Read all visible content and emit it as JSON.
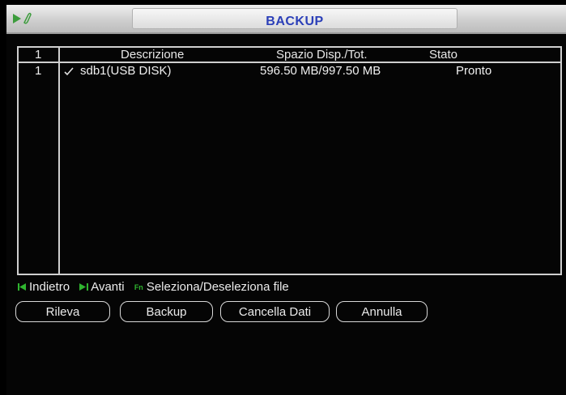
{
  "window": {
    "title": "BACKUP"
  },
  "table": {
    "headers": {
      "index": "1",
      "description": "Descrizione",
      "space": "Spazio Disp./Tot.",
      "status": "Stato"
    },
    "rows": [
      {
        "index": "1",
        "checked": true,
        "description": "sdb1(USB DISK)",
        "space": "596.50 MB/997.50 MB",
        "status": "Pronto"
      }
    ]
  },
  "hints": {
    "back": "Indietro",
    "forward": "Avanti",
    "fn_key": "Fn",
    "select": "Seleziona/Deseleziona file"
  },
  "buttons": {
    "detect": "Rileva",
    "backup": "Backup",
    "clear": "Cancella Dati",
    "cancel": "Annulla"
  },
  "colors": {
    "title_text": "#2b3fb8",
    "hint_icon": "#2fb52f",
    "logo": "#3c9c3c"
  },
  "icons": {
    "logo": "play-clip-icon",
    "check": "check-icon",
    "back": "skip-back-icon",
    "forward": "skip-forward-icon"
  }
}
